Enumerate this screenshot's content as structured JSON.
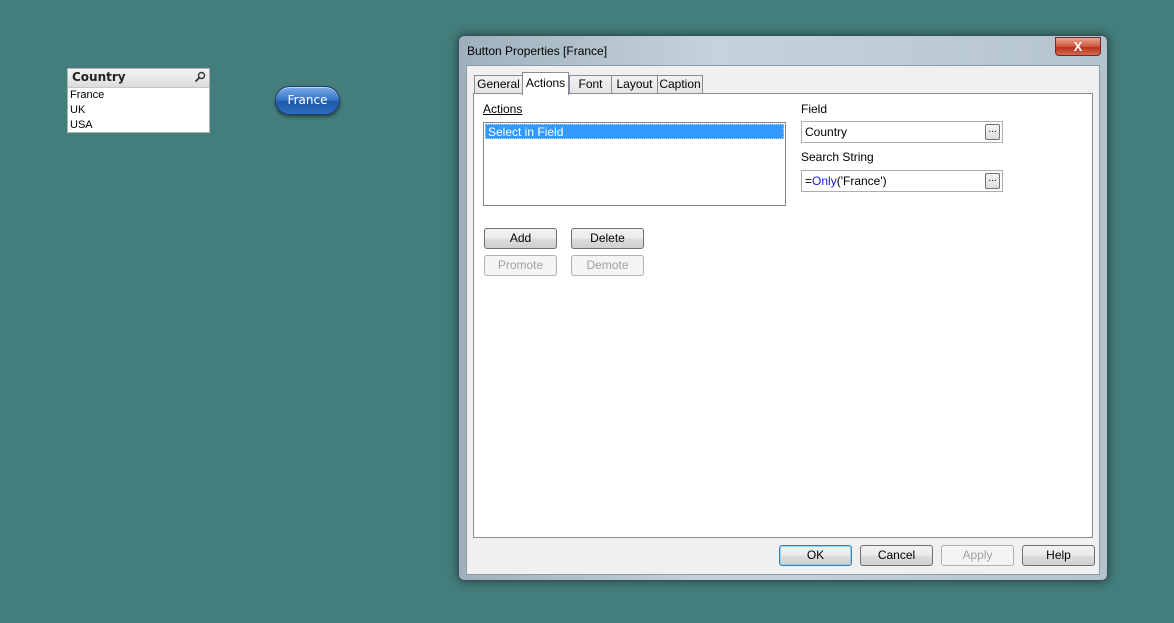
{
  "listbox": {
    "title": "Country",
    "items": [
      "France",
      "UK",
      "USA"
    ]
  },
  "sheet_button": {
    "label": "France"
  },
  "dialog": {
    "title": "Button Properties [France]",
    "close_glyph": "X",
    "tabs": [
      "General",
      "Actions",
      "Font",
      "Layout",
      "Caption"
    ],
    "active_tab": "Actions",
    "actions_label": "Actions",
    "actions_items": [
      "Select in Field"
    ],
    "field_label": "Field",
    "field_value": "Country",
    "search_label": "Search String",
    "search_value": {
      "prefix": "=",
      "function": "Only",
      "args": "('France')"
    },
    "ellipsis": "...",
    "buttons": {
      "add": "Add",
      "delete": "Delete",
      "promote": "Promote",
      "demote": "Demote"
    },
    "footer": {
      "ok": "OK",
      "cancel": "Cancel",
      "apply": "Apply",
      "help": "Help"
    }
  },
  "colors": {
    "desktop_background": "#437e7c",
    "selection": "#3399ff",
    "function_text": "#1a1adc"
  }
}
